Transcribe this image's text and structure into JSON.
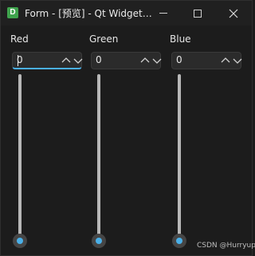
{
  "window": {
    "icon_letter": "D",
    "title": "Form - [预览] - Qt Widget…"
  },
  "colors": {
    "accent": "#4ab0e8",
    "background": "#1c1c1c",
    "icon_green": "#3fa34d"
  },
  "channels": [
    {
      "label": "Red",
      "spin_value": "0",
      "slider_value": 0,
      "slider_min": 0,
      "slider_max": 255,
      "focused": true
    },
    {
      "label": "Green",
      "spin_value": "0",
      "slider_value": 0,
      "slider_min": 0,
      "slider_max": 255,
      "focused": false
    },
    {
      "label": "Blue",
      "spin_value": "0",
      "slider_value": 0,
      "slider_min": 0,
      "slider_max": 255,
      "focused": false
    }
  ],
  "watermark": "CSDN @Hurryuppp"
}
